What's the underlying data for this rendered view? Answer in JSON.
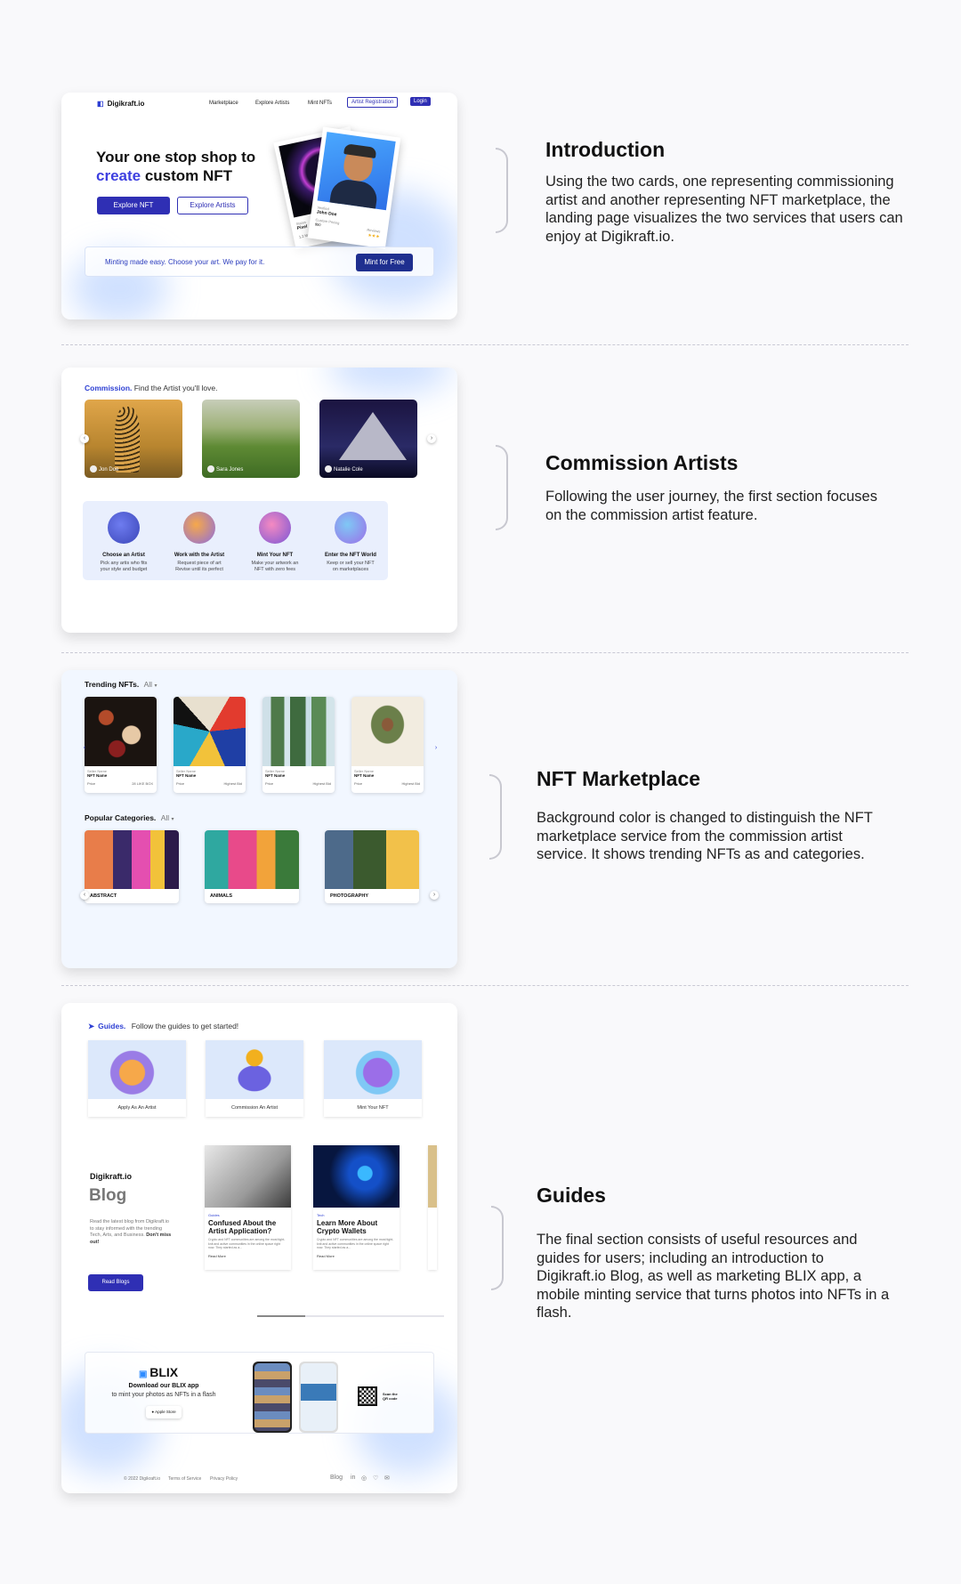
{
  "intro": {
    "nav": {
      "logo": "Digikraft.io",
      "links": [
        "Marketplace",
        "Explore Artists",
        "Mint NFTs"
      ],
      "artist_registration": "Artist Registration",
      "login": "Login"
    },
    "hero": {
      "line1": "Your one stop shop to",
      "accent": "create",
      "line2_rest": " custom NFT",
      "explore_nft": "Explore NFT",
      "explore_artists": "Explore Artists"
    },
    "back_card": {
      "label1": "Status",
      "value1": "Pixel",
      "label2": "1.2 Matic"
    },
    "front_card": {
      "verified": "Verified",
      "name": "John Doe",
      "pricing_label": "Custom Pricing",
      "pricing": "$50",
      "reviews_label": "Reviews",
      "stars": "★★★"
    },
    "mint_bar": {
      "text": "Minting made easy. Choose your art. We pay for it.",
      "button": "Mint for Free"
    }
  },
  "commission": {
    "title": "Commission.",
    "subtitle": " Find the Artist you'll love.",
    "artists": [
      "Jon Doe",
      "Sara Jones",
      "Natalie Cole"
    ],
    "steps": [
      {
        "title": "Choose an Artist",
        "desc": "Pick any artis who fits\nyour style and budget"
      },
      {
        "title": "Work with the Artist",
        "desc": "Request piece of art\nRevise until its perfect"
      },
      {
        "title": "Mint Your NFT",
        "desc": "Make your artwork an\nNFT with zero fees"
      },
      {
        "title": "Enter the NFT World",
        "desc": "Keep or sell your NFT\non marketplaces"
      }
    ]
  },
  "marketplace": {
    "trending_title": "Trending NFTs.",
    "trending_filter": "All",
    "nft_cards": [
      {
        "seller": "Seller Name",
        "name": "NFT Name",
        "price": "Price",
        "bid": "28 LIKE BOX"
      },
      {
        "seller": "Seller Name",
        "name": "NFT Name",
        "price": "Price",
        "bid": "Highest Bid"
      },
      {
        "seller": "Seller Name",
        "name": "NFT Name",
        "price": "Price",
        "bid": "Highest Bid"
      },
      {
        "seller": "Seller Name",
        "name": "NFT Name",
        "price": "Price",
        "bid": "Highest Bid"
      }
    ],
    "popular_title": "Popular Categories.",
    "popular_filter": "All",
    "categories": [
      "ABSTRACT",
      "ANIMALS",
      "PHOTOGRAPHY"
    ]
  },
  "guides": {
    "title": "Guides.",
    "subtitle": "Follow the guides to get started!",
    "cards": [
      "Apply As An Artist",
      "Commission An Artist",
      "Mint Your NFT"
    ],
    "blog": {
      "brand": "Digikraft.io",
      "heading": "Blog",
      "intro": "Read the latest blog from Digikraft.io to stay informed with the trending Tech, Arts, and Business.",
      "intro_bold": "Don't miss out!",
      "button": "Read Blogs",
      "posts": [
        {
          "tag": "Guides",
          "title": "Confused About the Artist Application?",
          "excerpt": "Crypto and NFT communities are among the most tight-knit and active communities in the online space right now. They started as a...",
          "more": "Read More"
        },
        {
          "tag": "Tech",
          "title": "Learn More About Crypto Wallets",
          "excerpt": "Crypto and NFT communities are among the most tight-knit and active communities in the online space right now. They started as a...",
          "more": "Read More"
        }
      ]
    },
    "blix": {
      "logo": "BLIX",
      "line1": "Download our BLIX app",
      "line2": "to mint your photos as NFTs in a flash",
      "store": "Apple Store",
      "scan": "Scan the QR code"
    },
    "footer": {
      "copyright": "© 2022 Digikraft.io",
      "terms": "Terms of Service",
      "privacy": "Privacy Policy",
      "blog": "Blog"
    }
  },
  "descriptions": [
    {
      "title": "Introduction",
      "body": "Using the two cards, one representing commissioning artist and another representing NFT marketplace, the landing page visualizes the two services that users can enjoy at Digikraft.io."
    },
    {
      "title": "Commission Artists",
      "body": "Following the user journey, the first section focuses on the commission artist feature."
    },
    {
      "title": "NFT Marketplace",
      "body": "Background color is changed to distinguish the NFT marketplace service from the commission artist service. It shows trending NFTs as and categories."
    },
    {
      "title": "Guides",
      "body": "The final section consists of useful resources and guides for users; including an introduction to  Digikraft.io Blog, as well as marketing BLIX app, a mobile minting service that turns photos into NFTs in a flash."
    }
  ],
  "colors": {
    "accent": "#2f2fb4",
    "brand_blue": "#2d3fd3",
    "page_bg": "#f9f9fb"
  }
}
